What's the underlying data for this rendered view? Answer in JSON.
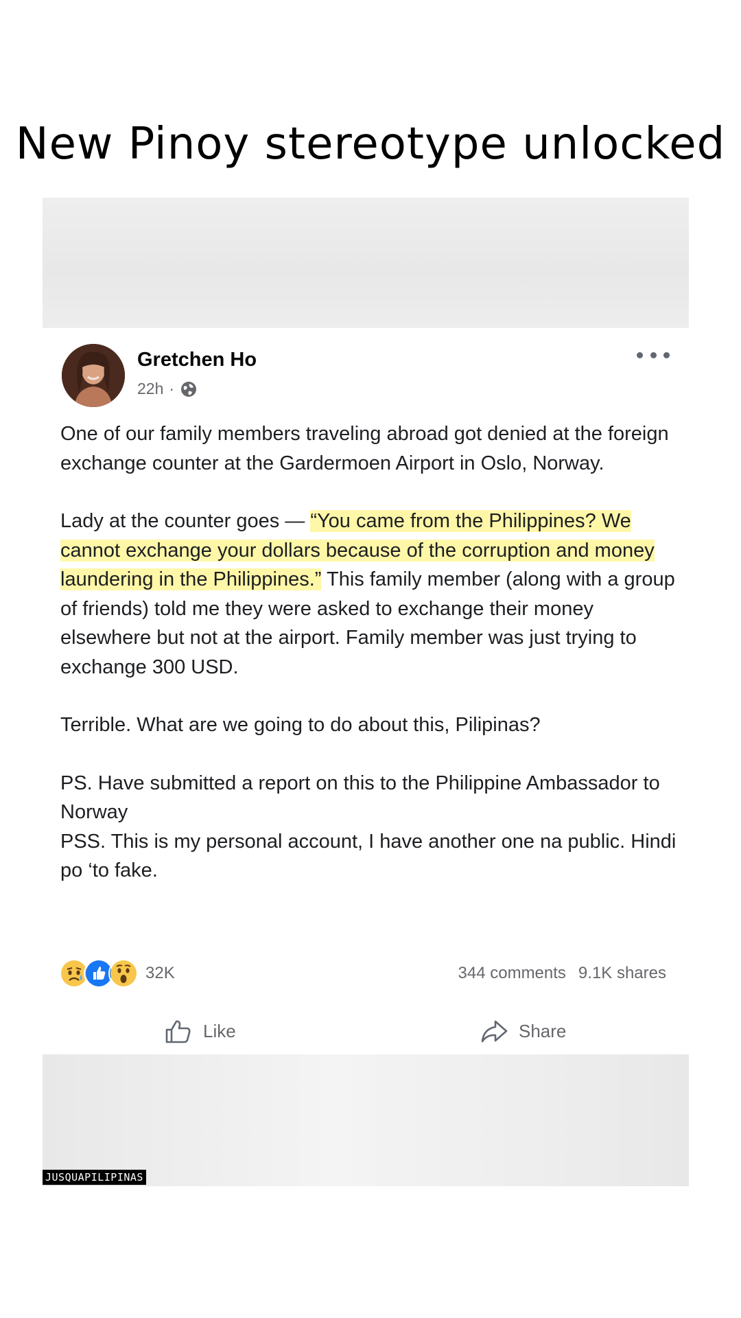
{
  "caption": "New Pinoy stereotype unlocked",
  "post": {
    "author": "Gretchen Ho",
    "time": "22h",
    "separator": "·",
    "privacy_icon": "globe-icon",
    "more_icon": "more-horizontal-icon",
    "paragraphs": {
      "p1": "One of our family members traveling abroad got denied at the foreign exchange counter at the Gardermoen Airport in Oslo, Norway.",
      "p2_intro": "Lady at the counter goes — ",
      "p2_quote": "“You came from the Philippines? We cannot exchange your dollars because of the corruption and money laundering in the Philippines.”",
      "p2_rest": " This family member (along with a group of friends) told me they were asked to exchange their money elsewhere but not at the airport. Family member was just trying to exchange 300 USD.",
      "p3": "Terrible. What are we going to do about this, Pilipinas?",
      "p4_line1": "PS. Have submitted a report on this to the Philippine Ambassador to Norway",
      "p4_line2": "PSS. This is my personal account, I have another one na public. Hindi po ‘to fake."
    },
    "reactions": {
      "icons": [
        "sad-reaction-icon",
        "like-reaction-icon",
        "wow-reaction-icon"
      ],
      "count": "32K"
    },
    "comments": "344 comments",
    "shares": "9.1K shares",
    "actions": {
      "like": "Like",
      "share": "Share"
    },
    "highlight_color": "#fff7a8"
  },
  "watermark": "JUSQUAPILIPINAS"
}
